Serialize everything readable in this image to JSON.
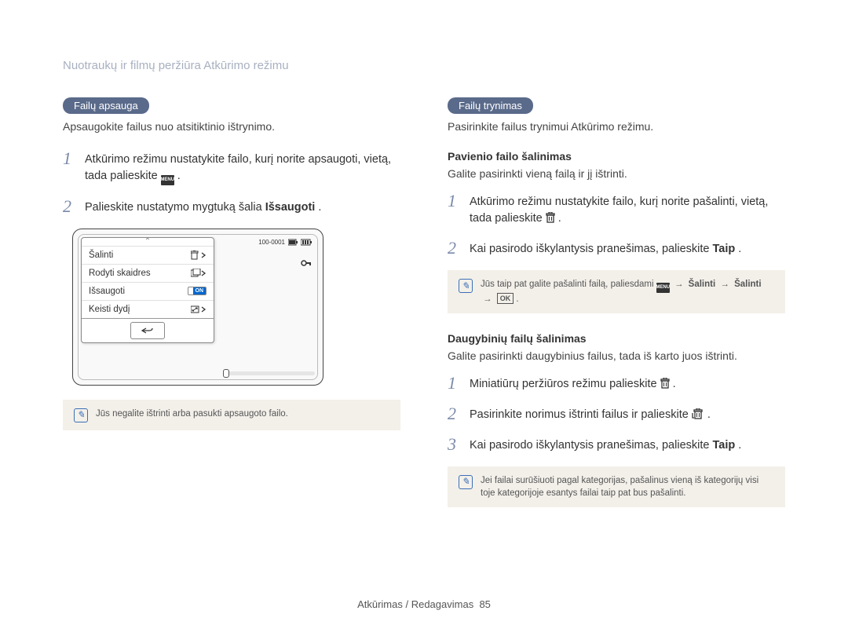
{
  "header": "Nuotraukų ir filmų peržiūra Atkūrimo režimu",
  "left": {
    "pill": "Failų apsauga",
    "intro": "Apsaugokite failus nuo atsitiktinio ištrynimo.",
    "step1_pre": "Atkūrimo režimu nustatykite failo, kurį norite apsaugoti, vietą, tada palieskite ",
    "menu_label": "MENU",
    "step1_post": ".",
    "step2_pre": "Palieskite nustatymo mygtuką šalia ",
    "step2_bold": "Išsaugoti",
    "step2_post": ".",
    "screen": {
      "counter": "100-0001",
      "item_delete": "Šalinti",
      "item_slides": "Rodyti skaidres",
      "item_save": "Išsaugoti",
      "toggle_on": "ON",
      "item_resize": "Keisti dydį"
    },
    "note": "Jūs negalite ištrinti arba pasukti apsaugoto failo."
  },
  "right": {
    "pill": "Failų trynimas",
    "intro": "Pasirinkite failus trynimui Atkūrimo režimu.",
    "section1_heading": "Pavienio failo šalinimas",
    "section1_intro": "Galite pasirinkti vieną failą ir jį ištrinti.",
    "s1_step1_pre": "Atkūrimo režimu nustatykite failo, kurį norite pašalinti, vietą, tada palieskite ",
    "s1_step1_post": ".",
    "s1_step2_pre": "Kai pasirodo iškylantysis pranešimas, palieskite ",
    "s1_step2_bold": "Taip",
    "s1_step2_post": ".",
    "note1_pre": "Jūs taip pat galite pašalinti failą, paliesdami ",
    "menu_label": "MENU",
    "note1_arrow": "→",
    "note1_b1": "Šalinti",
    "note1_b2": "Šalinti",
    "note1_ok": "OK",
    "section2_heading": "Daugybinių failų šalinimas",
    "section2_intro": "Galite pasirinkti daugybinius failus, tada iš karto juos ištrinti.",
    "s2_step1_pre": "Miniatiūrų peržiūros režimu palieskite ",
    "s2_step1_post": ".",
    "s2_step2_pre": "Pasirinkite norimus ištrinti failus ir palieskite ",
    "s2_step2_post": ".",
    "s2_step3_pre": "Kai pasirodo iškylantysis pranešimas, palieskite ",
    "s2_step3_bold": "Taip",
    "s2_step3_post": ".",
    "note2": "Jei failai surūšiuoti pagal kategorijas, pašalinus vieną iš kategorijų visi toje kategorijoje esantys failai taip pat bus pašalinti."
  },
  "footer_label": "Atkūrimas / Redagavimas",
  "footer_page": "85"
}
